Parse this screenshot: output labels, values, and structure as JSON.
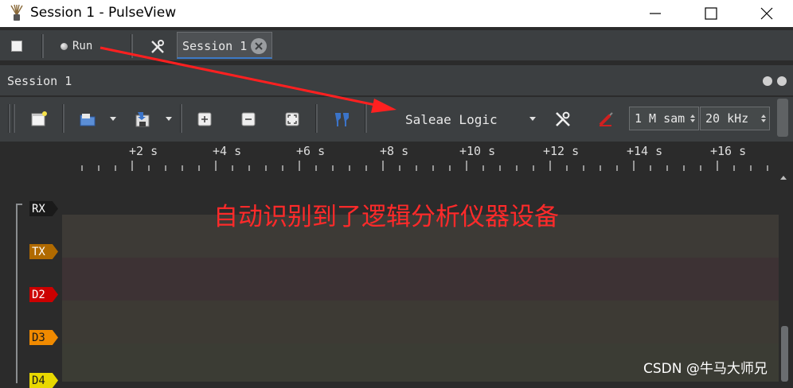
{
  "window": {
    "title": "Session 1 - PulseView",
    "controls": {
      "minimize": "minimize-icon",
      "maximize": "maximize-icon",
      "close": "close-icon"
    }
  },
  "top_toolbar": {
    "run_label": "Run",
    "session_tab_label": "Session 1"
  },
  "dock": {
    "title": "Session 1"
  },
  "main_toolbar": {
    "device": "Saleae Logic",
    "sample_count": "1 M sam",
    "sample_rate": "20 kHz"
  },
  "ruler": {
    "ticks": [
      "+2 s",
      "+4 s",
      "+6 s",
      "+8 s",
      "+10 s",
      "+12 s",
      "+14 s",
      "+16 s"
    ]
  },
  "channels": [
    {
      "name": "RX",
      "color": "#1a1a1a",
      "text_color": "#ffffff"
    },
    {
      "name": "TX",
      "color": "#b06a00",
      "text_color": "#ffffff"
    },
    {
      "name": "D2",
      "color": "#cc0000",
      "text_color": "#ffffff"
    },
    {
      "name": "D3",
      "color": "#f08a00",
      "text_color": "#1a1a1a"
    },
    {
      "name": "D4",
      "color": "#e8d800",
      "text_color": "#1a1a1a"
    }
  ],
  "annotation": {
    "text": "自动识别到了逻辑分析仪器设备",
    "color": "#ff2a2a"
  },
  "watermark": "CSDN @牛马大师兄"
}
